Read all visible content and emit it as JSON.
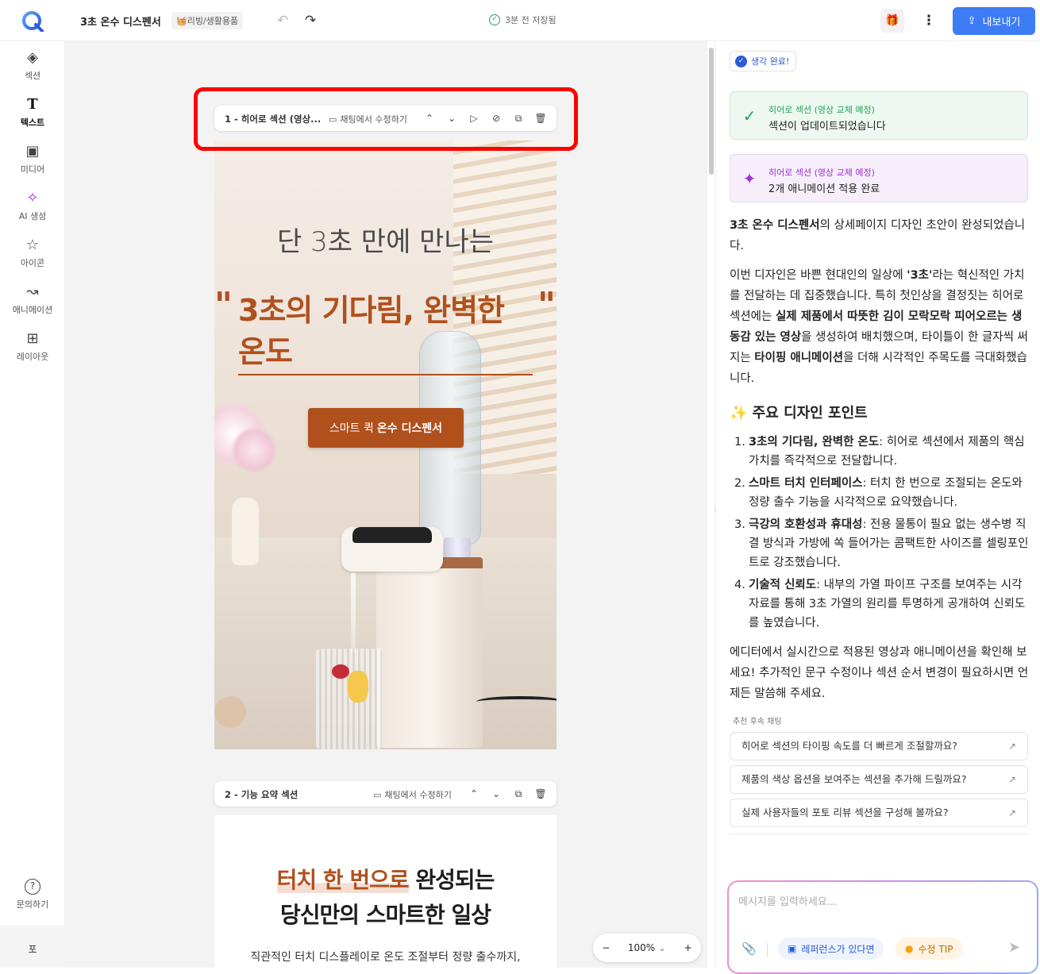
{
  "header": {
    "doc_title": "3초 온수 디스펜서",
    "category": "🧺리빙/생활용품",
    "saved_status": "3분 전 저장됨",
    "export_label": "내보내기"
  },
  "sidebar": {
    "items": [
      {
        "label": "섹션",
        "icon": "layers-icon"
      },
      {
        "label": "텍스트",
        "icon": "text-icon"
      },
      {
        "label": "미디어",
        "icon": "image-icon"
      },
      {
        "label": "AI 생성",
        "icon": "magic-wand-icon"
      },
      {
        "label": "아이콘",
        "icon": "star-icon"
      },
      {
        "label": "애니메이션",
        "icon": "curve-icon"
      },
      {
        "label": "레이아웃",
        "icon": "grid-icon"
      }
    ],
    "help_label": "문의하기",
    "lang_label": "포"
  },
  "canvas": {
    "section1": {
      "label": "1 - 히어로 섹션 (영상...",
      "chat_edit": "채팅에서 수정하기",
      "hero_sub": "단 3초 만에 만나는",
      "hero_title": "3초의 기다림, 완벽한 온도",
      "quote_open": "\"",
      "quote_close": "\"",
      "cta_light": "스마트 퀵",
      "cta_bold": "온수 디스펜서"
    },
    "section2": {
      "label": "2 - 기능 요약 섹션",
      "chat_edit": "채팅에서 수정하기",
      "heading_highlight": "터치 한 번으로",
      "heading_rest": "완성되는",
      "heading_line2": "당신만의 스마트한 일상",
      "paragraph": "직관적인 터치 디스플레이로 온도 조절부터 정량 출수까지,"
    },
    "zoom": {
      "minus": "−",
      "value": "100%",
      "caret": "⌄",
      "plus": "+"
    }
  },
  "chat": {
    "thinking_done": "생각 완료!",
    "card_green": {
      "title": "히어로 섹션 (영상 교체 예정)",
      "body": "섹션이 업데이트되었습니다"
    },
    "card_purple": {
      "title": "히어로 섹션 (영상 교체 예정)",
      "body": "2개 애니메이션 적용 완료"
    },
    "intro_bold": "3초 온수 디스펜서",
    "intro_rest": "의 상세페이지 디자인 초안이 완성되었습니다.",
    "p2": {
      "a": "이번 디자인은 바쁜 현대인의 일상에 ",
      "b": "'3초'",
      "c": "라는 혁신적인 가치를 전달하는 데 집중했습니다. 특히 첫인상을 결정짓는 히어로 섹션에는 ",
      "d": "실제 제품에서 따뜻한 김이 모락모락 피어오르는 생동감 있는 영상",
      "e": "을 생성하여 배치했으며, 타이틀이 한 글자씩 써지는 ",
      "f": "타이핑 애니메이션",
      "g": "을 더해 시각적인 주목도를 극대화했습니다."
    },
    "heading": "✨ 주요 디자인 포인트",
    "points": [
      {
        "num": "1.",
        "bold": "3초의 기다림, 완벽한 온도",
        "rest": ": 히어로 섹션에서 제품의 핵심 가치를 즉각적으로 전달합니다."
      },
      {
        "num": "2.",
        "bold": "스마트 터치 인터페이스",
        "rest": ": 터치 한 번으로 조절되는 온도와 정량 출수 기능을 시각적으로 요약했습니다."
      },
      {
        "num": "3.",
        "bold": "극강의 호환성과 휴대성",
        "rest": ": 전용 물통이 필요 없는 생수병 직결 방식과 가방에 쏙 들어가는 콤팩트한 사이즈를 셀링포인트로 강조했습니다."
      },
      {
        "num": "4.",
        "bold": "기술적 신뢰도",
        "rest": ": 내부의 가열 파이프 구조를 보여주는 시각 자료를 통해 3초 가열의 원리를 투명하게 공개하여 신뢰도를 높였습니다."
      }
    ],
    "outro": "에디터에서 실시간으로 적용된 영상과 애니메이션을 확인해 보세요! 추가적인 문구 수정이나 섹션 순서 변경이 필요하시면 언제든 말씀해 주세요.",
    "suggest_label": "추천 후속 채팅",
    "suggestions": [
      "히어로 섹션의 타이핑 속도를 더 빠르게 조절할까요?",
      "제품의 색상 옵션을 보여주는 섹션을 추가해 드릴까요?",
      "실제 사용자들의 포토 리뷰 섹션을 구성해 볼까요?"
    ],
    "input_placeholder": "메시지를 입력하세요...",
    "reference_label": "레퍼런스가 있다면",
    "tip_label": "수정 TIP"
  },
  "colors": {
    "accent": "#3d7cf4",
    "brand": "#b0501c",
    "highlight_frame": "#ff0000"
  }
}
